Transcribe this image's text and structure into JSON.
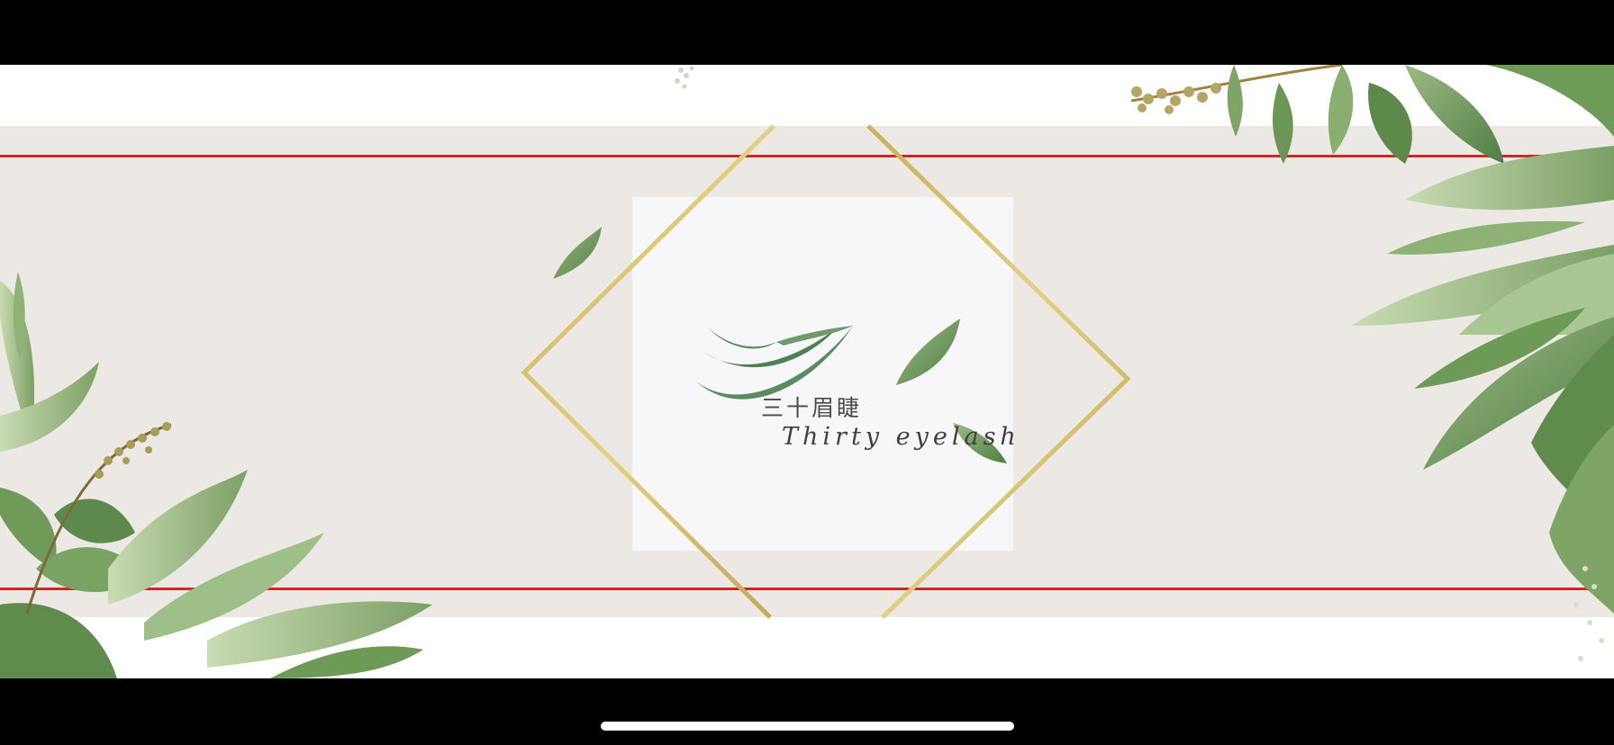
{
  "brand": {
    "name_zh": "三十眉睫",
    "name_en": "Thirty eyelash"
  },
  "icons": {
    "logo": "eyelash-swoosh-logo-icon",
    "decor": [
      "leaf-cluster-left",
      "leaf-cluster-right",
      "floating-leaf"
    ]
  },
  "colors": {
    "band": "#ece9e4",
    "accent_red": "#c92a26",
    "frame_gold": "#d4bf6a",
    "leaf_green": "#5e8f4e",
    "logo_green": "#4f7f55"
  }
}
